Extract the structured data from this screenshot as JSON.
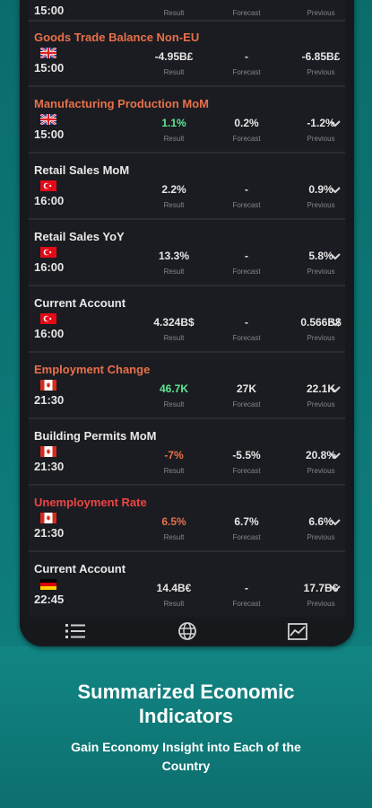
{
  "top_row": {
    "time": "15:00",
    "result_label": "Result",
    "forecast_label": "Forecast",
    "previous_label": "Previous"
  },
  "rows": [
    {
      "title": "Goods Trade Balance Non-EU",
      "impact": "medium",
      "flag": "uk-flag-icon",
      "time": "15:00",
      "result": "-4.95B£",
      "forecast": "-",
      "previous": "-6.85B£",
      "result_color": "white",
      "expandable": false
    },
    {
      "title": "Manufacturing Production MoM",
      "impact": "medium",
      "flag": "uk-flag-icon",
      "time": "15:00",
      "result": "1.1%",
      "forecast": "0.2%",
      "previous": "-1.2%",
      "result_color": "green",
      "expandable": true
    },
    {
      "title": "Retail Sales MoM",
      "impact": "low",
      "flag": "turkey-flag-icon",
      "time": "16:00",
      "result": "2.2%",
      "forecast": "-",
      "previous": "0.9%",
      "result_color": "white",
      "expandable": true
    },
    {
      "title": "Retail Sales YoY",
      "impact": "low",
      "flag": "turkey-flag-icon",
      "time": "16:00",
      "result": "13.3%",
      "forecast": "-",
      "previous": "5.8%",
      "result_color": "white",
      "expandable": true
    },
    {
      "title": "Current Account",
      "impact": "low",
      "flag": "turkey-flag-icon",
      "time": "16:00",
      "result": "4.324B$",
      "forecast": "-",
      "previous": "0.566B$",
      "result_color": "white",
      "expandable": true
    },
    {
      "title": "Employment Change",
      "impact": "medium",
      "flag": "canada-flag-icon",
      "time": "21:30",
      "result": "46.7K",
      "forecast": "27K",
      "previous": "22.1K",
      "result_color": "green",
      "expandable": true
    },
    {
      "title": "Building Permits MoM",
      "impact": "low",
      "flag": "canada-flag-icon",
      "time": "21:30",
      "result": "-7%",
      "forecast": "-5.5%",
      "previous": "20.8%",
      "result_color": "orange",
      "expandable": true
    },
    {
      "title": "Unemployment Rate",
      "impact": "high",
      "flag": "canada-flag-icon",
      "time": "21:30",
      "result": "6.5%",
      "forecast": "6.7%",
      "previous": "6.6%",
      "result_color": "orange",
      "expandable": true
    },
    {
      "title": "Current Account",
      "impact": "low",
      "flag": "germany-flag-icon",
      "time": "22:45",
      "result": "14.4B€",
      "forecast": "-",
      "previous": "17.7B€",
      "result_color": "white",
      "expandable": true
    }
  ],
  "labels": {
    "result": "Result",
    "forecast": "Forecast",
    "previous": "Previous"
  },
  "tabs": [
    {
      "icon": "list-icon"
    },
    {
      "icon": "globe-icon"
    },
    {
      "icon": "chart-icon"
    }
  ],
  "promo": {
    "headline_line1": "Summarized Economic",
    "headline_line2": "Indicators",
    "sub_line1": "Gain Economy Insight into Each of the",
    "sub_line2": "Country"
  },
  "colors": {
    "background": "#0f7a78",
    "panel": "#1b1c21",
    "green": "#5ee894",
    "orange": "#e8704a",
    "red": "#ee4444"
  }
}
